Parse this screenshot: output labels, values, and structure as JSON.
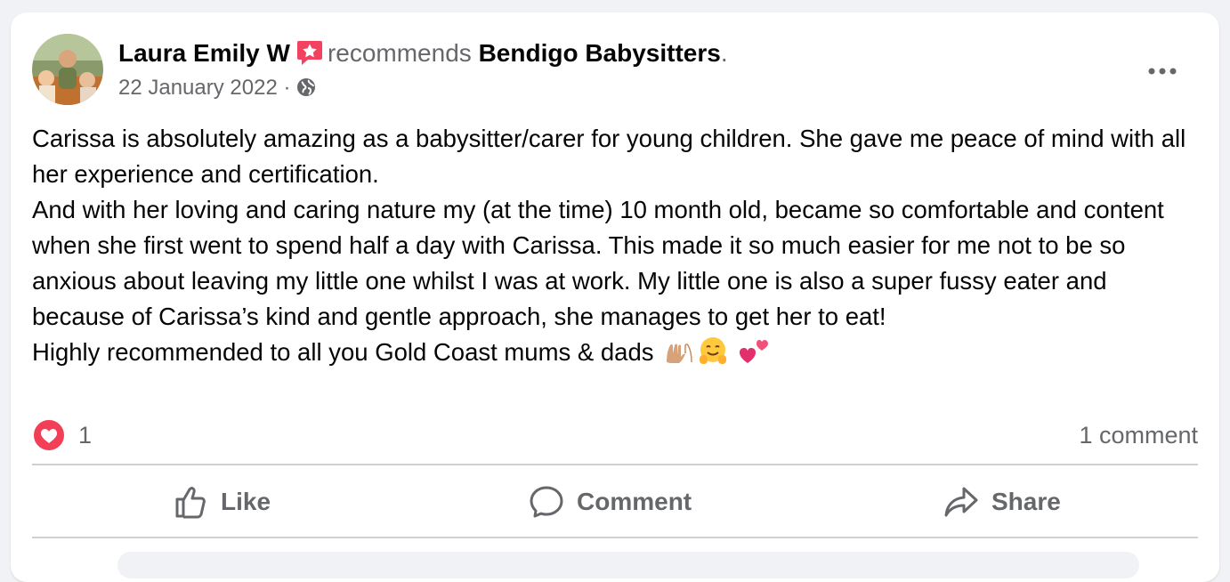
{
  "post": {
    "author": "Laura Emily W",
    "action_text": "recommends",
    "page_name": "Bendigo Babysitters",
    "trailing_punct": ".",
    "date": "22 January 2022",
    "separator": "·",
    "more_label": "•••",
    "body": [
      "Carissa is absolutely amazing as a babysitter/carer for young children. She gave me peace of mind with all her experience and certification.",
      "And with her loving and caring nature my (at the time) 10 month old, became so comfortable and content when she first went to spend half a day with Carissa. This made it so much easier for me not to be so anxious about leaving my little one whilst I was at work. My little one is also a super fussy eater and because of Carissa’s kind and gentle approach, she manages to get her to eat!",
      "Highly recommended to all you Gold Coast mums & dads"
    ]
  },
  "stats": {
    "reaction_count": "1",
    "comment_count": "1 comment"
  },
  "actions": {
    "like": "Like",
    "comment": "Comment",
    "share": "Share"
  },
  "colors": {
    "recommend_accent": "#f3425f",
    "heart_reaction": "#f33e58",
    "muted_text": "#65676b",
    "divider": "#ced0d4"
  }
}
